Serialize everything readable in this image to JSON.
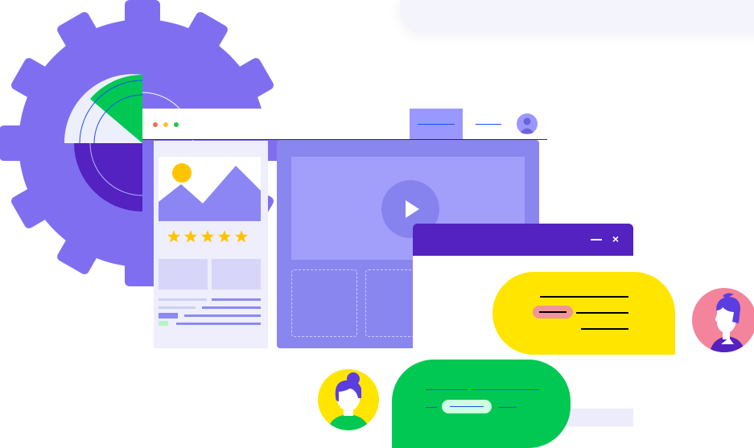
{
  "illustration": {
    "icons": [
      "gear-icon",
      "radar-icon",
      "window-dots-icon",
      "user-avatar-icon",
      "image-placeholder-icon",
      "star-icon",
      "play-icon",
      "minimize-icon",
      "close-icon",
      "male-avatar-icon",
      "female-avatar-icon"
    ],
    "rating": {
      "stars": 5,
      "of": 5
    },
    "chat_window": {
      "close_label": "×"
    },
    "colors": {
      "gear": "#7f6ff0",
      "chat_header": "#5322c0",
      "bubble_yellow": "#ffe500",
      "bubble_green": "#00c853",
      "accent_blue": "#1a4fff",
      "window_dot_red": "#f76b51",
      "window_dot_yellow": "#ffc02e",
      "window_dot_green": "#21c453"
    }
  }
}
